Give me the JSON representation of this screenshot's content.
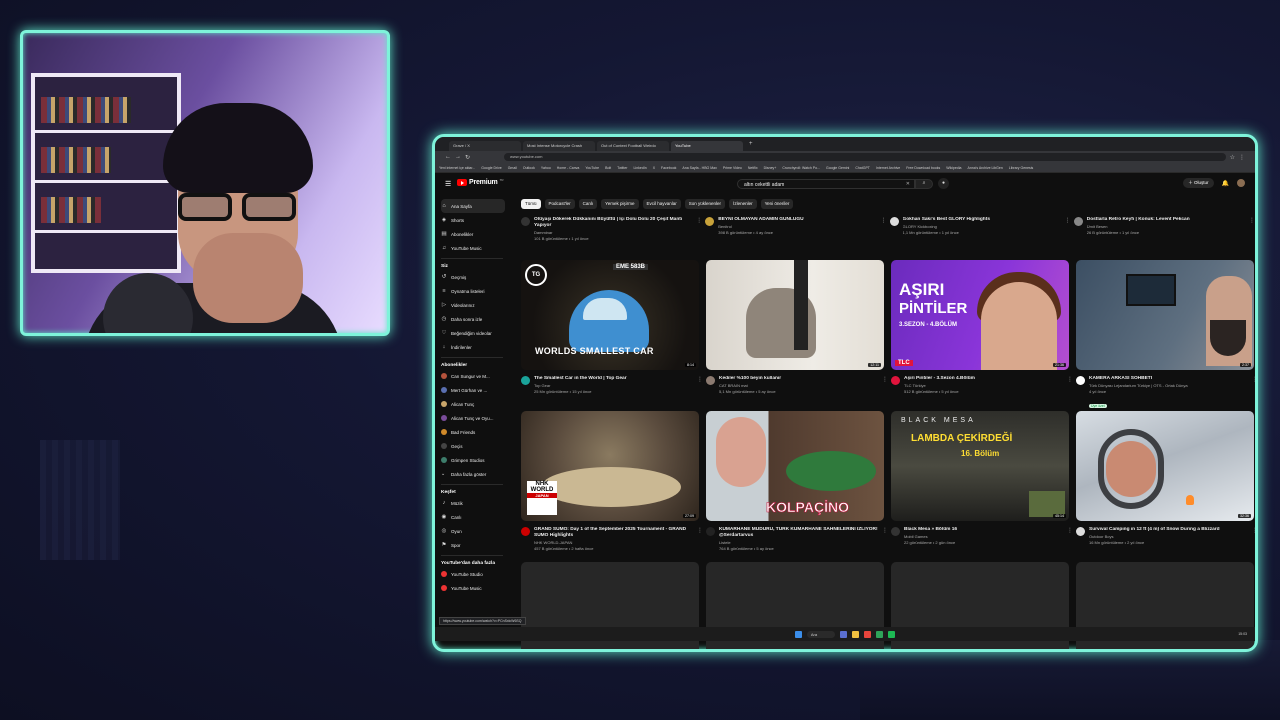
{
  "browser": {
    "tabs": [
      "Grave / X",
      "Most Intense Motorcycle Crash",
      "Out of Context Football Weirdo",
      "YouTube"
    ],
    "active_tab": 3,
    "url": "www.youtube.com",
    "bookmarks": [
      "Yeni internet içe aktar...",
      "Google Drive",
      "Gmail",
      "Outlook",
      "Yahoo",
      "Home - Canva",
      "YouTube",
      "Bolt",
      "Twitter",
      "LinkedIn",
      "X",
      "Facebook",
      "Ana Sayfa - HBO Max",
      "Prime Video",
      "Netflix",
      "Disney+",
      "Crunchyroll: Watch Po...",
      "Google Gemini",
      "ChatGPT",
      "Internet Archive",
      "Free Download books",
      "Wikipedia",
      "Anna's Archive LibGen",
      "Library Genesis"
    ],
    "status_url": "https://www.youtube.com/watch?v=PCnSxlcW6SQ"
  },
  "youtube": {
    "logo": "Premium",
    "logo_region": "TR",
    "search_value": "altın cekettli adam",
    "create_label": "Oluştur",
    "chips": [
      "Tümü",
      "Podcast'ler",
      "Canlı",
      "Yemek pişirme",
      "Evcil hayvanlar",
      "Son yüklenenler",
      "İzlenenler",
      "Yeni öneriler"
    ],
    "sidebar": {
      "main": [
        {
          "icon": "home-icon",
          "glyph": "⌂",
          "label": "Ana Sayfa"
        },
        {
          "icon": "shorts-icon",
          "glyph": "◈",
          "label": "Shorts"
        },
        {
          "icon": "subscriptions-icon",
          "glyph": "▤",
          "label": "Abonelikler"
        },
        {
          "icon": "music-icon",
          "glyph": "♫",
          "label": "YouTube Music"
        }
      ],
      "you_title": "Siz",
      "you": [
        {
          "icon": "history-icon",
          "glyph": "↺",
          "label": "Geçmiş"
        },
        {
          "icon": "playlist-icon",
          "glyph": "≡",
          "label": "Oynatma listeleri"
        },
        {
          "icon": "your-videos-icon",
          "glyph": "▷",
          "label": "Videolarınız"
        },
        {
          "icon": "watch-later-icon",
          "glyph": "◷",
          "label": "Daha sonra izle"
        },
        {
          "icon": "liked-icon",
          "glyph": "♡",
          "label": "Beğendiğim videolar"
        },
        {
          "icon": "downloads-icon",
          "glyph": "↓",
          "label": "İndirilenler"
        }
      ],
      "subs_title": "Abonelikler",
      "subs": [
        {
          "label": "Can Sungur ve M...",
          "color": "#b5533c"
        },
        {
          "label": "Mert Gürhan ve ...",
          "color": "#5a6fb0"
        },
        {
          "label": "Alican Tunç",
          "color": "#c9a66b"
        },
        {
          "label": "Alican Tunç ve Oyu...",
          "color": "#7a4c9a"
        },
        {
          "label": "Bad Friends",
          "color": "#d08a2a"
        },
        {
          "label": "Geçis",
          "color": "#444"
        },
        {
          "label": "Grimpen Studios",
          "color": "#3d7d6b"
        },
        {
          "label": "Daha fazla göster",
          "color": ""
        }
      ],
      "explore_title": "Keşfet",
      "explore": [
        {
          "icon": "music-note-icon",
          "glyph": "♪",
          "label": "Müzik"
        },
        {
          "icon": "live-icon",
          "glyph": "◉",
          "label": "Canlı"
        },
        {
          "icon": "gaming-icon",
          "glyph": "◎",
          "label": "Oyun"
        },
        {
          "icon": "sports-icon",
          "glyph": "⚑",
          "label": "Spor"
        }
      ],
      "more_title": "YouTube'dan daha fazla",
      "more": [
        {
          "label": "YouTube Studio"
        },
        {
          "label": "YouTube Music"
        }
      ]
    },
    "top_row": [
      {
        "title": "Ölüyaşı Dökerek Dükkanını Büyüttü | İçi Dolu Dolu 20 Çeşit Mantı Yapıyor",
        "channel": "Damminar",
        "stats": "101 B görüntüleme • 1 yıl önce",
        "color": "#333"
      },
      {
        "title": "BEYNİ OLMAYAN ADAMIN GÜNLÜĞÜ",
        "channel": "Benitrol",
        "stats": "398 B görüntüleme • 4 ay önce",
        "color": "#c8a23a"
      },
      {
        "title": "Gokhan Saki's Best GLORY Highlights",
        "channel": "GLORY Kickboxing",
        "stats": "1,1 Mn görüntüleme • 1 yıl önce",
        "color": "#ddd"
      },
      {
        "title": "Dostlarla Retro Keyfi | Konuk: Levent Pekcan",
        "channel": "Ümit Besen",
        "stats": "26 B görüntüleme • 1 yıl önce",
        "color": "#888"
      }
    ],
    "row1": [
      {
        "title": "The Smallest Car in the World | Top Gear",
        "channel": "Top Gear",
        "stats": "25 Mn görüntüleme • 15 yıl önce",
        "duration": "8:14",
        "thumb_text": "WORLDS SMALLEST CAR",
        "plate": "EME 583B",
        "logo": "TG",
        "avatar": "#1aa39a"
      },
      {
        "title": "Kediler %100 beyin kullanır",
        "channel": "CAT BRAIN mat",
        "stats": "5,1 Mn görüntüleme • 5 ay önce",
        "duration": "12:11",
        "avatar": "#8b7a70"
      },
      {
        "title": "Aşırı Pintiler - 3.Sezon 4.Bölüm",
        "channel": "TLC Türkiye",
        "stats": "512 B görüntüleme • 5 yıl önce",
        "duration": "21:36",
        "thumb_w1": "AŞIRI",
        "thumb_w2": "PİNTİLER",
        "thumb_w3": "3.SEZON - 4.BÖLÜM",
        "thumb_tlc": "TLC",
        "avatar": "#e0143c"
      },
      {
        "title": "KAMERA ARKASI SOHBETİ",
        "channel": "Türk Dünyası Lejandarium Türkiye | OTS - Ortak Dünya",
        "stats": "4 yıl önce",
        "duration": "2:37",
        "badge": "Üye özel",
        "avatar": "#fff"
      }
    ],
    "row2": [
      {
        "title": "GRAND SUMO: Day 1 of the September 2025 Tournament - GRAND SUMO Highlights",
        "channel": "NHK WORLD-JAPAN",
        "stats": "457 B görüntüleme • 2 hafta önce",
        "duration": "27:09",
        "nhk1": "NHK",
        "nhk2": "WORLD",
        "nhk3": "JAPAN",
        "avatar": "#c00"
      },
      {
        "title": "KUMARHANE MÜDÜRÜ, TÜRK KUMARHANE SAHNELERİNİ İZLİYOR! @Serdartarvus",
        "channel": "Listele",
        "stats": "764 B görüntüleme • 5 ay önce",
        "duration": "",
        "thumb_text": "KOLPAÇİNO",
        "avatar": "#222"
      },
      {
        "title": "Black Mesa » Bölüm 16",
        "channel": "Mobil Games",
        "stats": "22 görüntüleme • 2 gün önce",
        "duration": "45:14",
        "thumb_bm": "BLACK MESA",
        "thumb_lc": "LAMBDA ÇEKİRDEĞİ",
        "thumb_bol": "16. Bölüm",
        "avatar": "#333"
      },
      {
        "title": "Survival Camping in 12 ft (4 m) of Snow During a Blizzard",
        "channel": "Outdoor Boys",
        "stats": "16 Mn görüntüleme • 2 yıl önce",
        "duration": "32:36",
        "avatar": "#ddd"
      }
    ],
    "search_placeholder_btn": "⌕"
  },
  "taskbar": {
    "search_label": "Ara",
    "tray": "15:03"
  }
}
